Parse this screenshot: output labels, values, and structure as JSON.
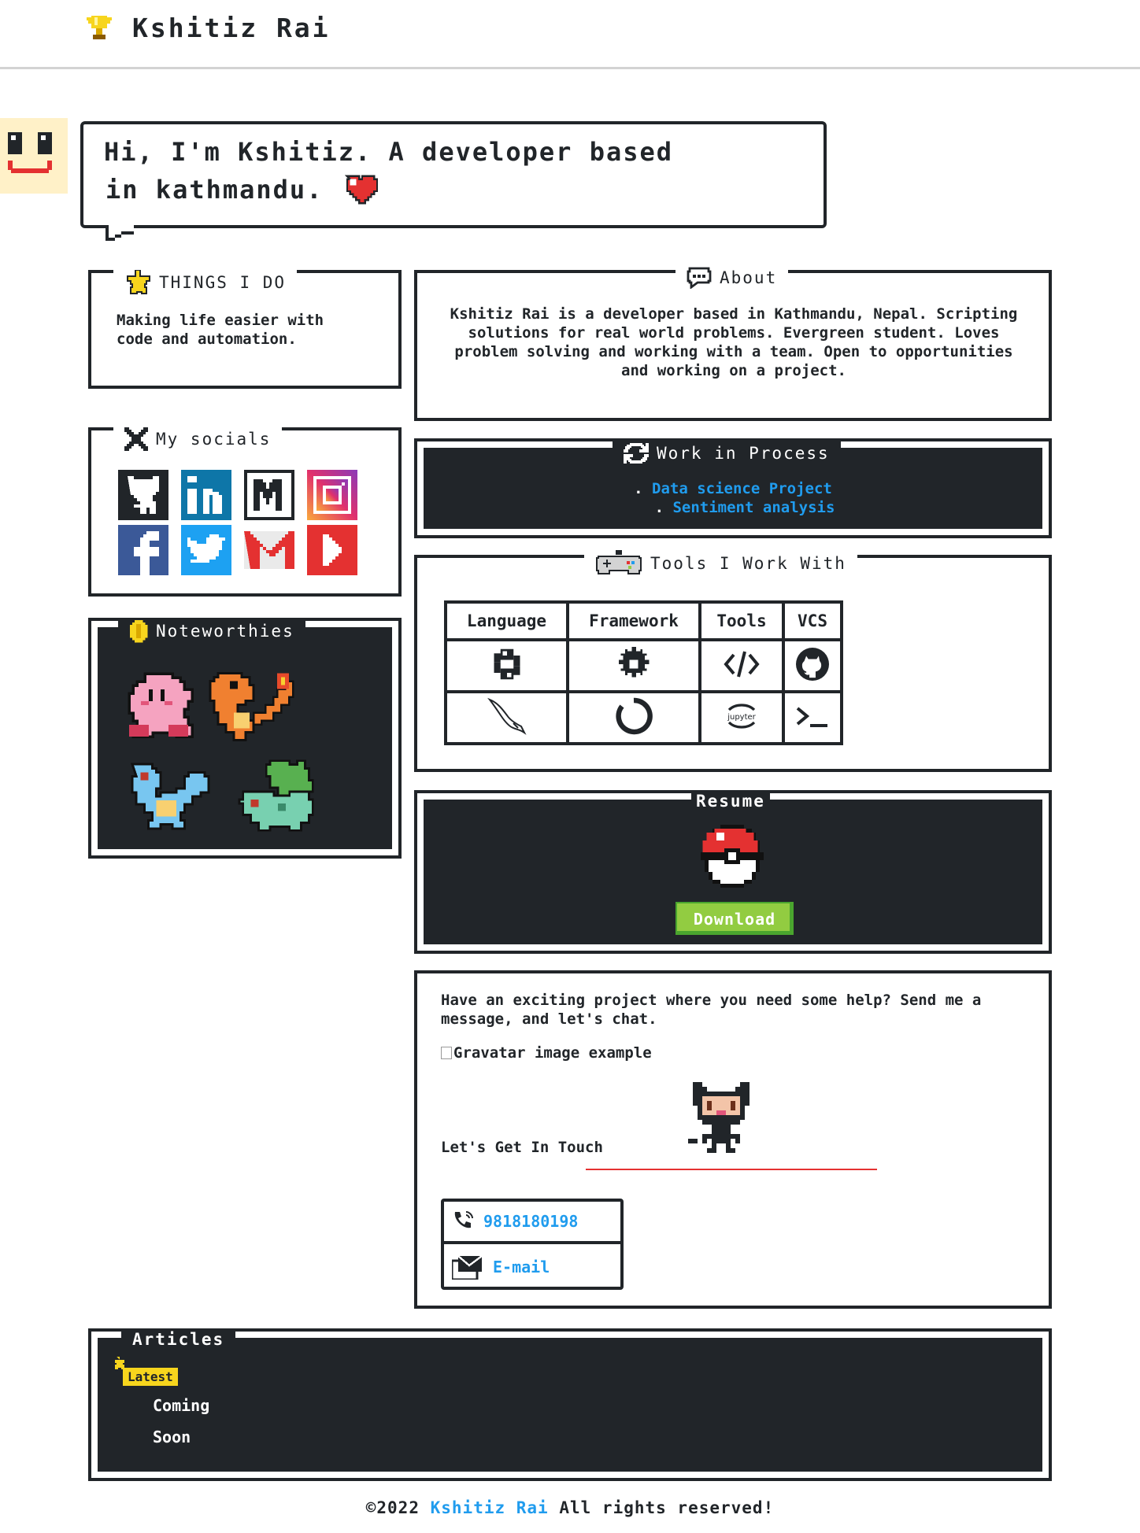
{
  "header": {
    "site_title": "Kshitiz Rai",
    "trophy_icon": "trophy-icon"
  },
  "greeting": {
    "line1": "Hi, I'm Kshitiz. A developer based",
    "line2": "in kathmandu."
  },
  "things_i_do": {
    "title": "THINGS I DO",
    "text": "Making life easier with code and automation."
  },
  "about": {
    "title": "About",
    "text": "Kshitiz Rai is a developer based in Kathmandu, Nepal. Scripting solutions for real world problems. Evergreen student. Loves problem solving and working with a team. Open to opportunities and working on a project."
  },
  "socials": {
    "title": "My socials",
    "items": [
      "github",
      "linkedin",
      "medium",
      "instagram",
      "facebook",
      "twitter",
      "gmail",
      "youtube"
    ]
  },
  "work": {
    "title": "Work in Process",
    "items": [
      "Data science Project",
      "Sentiment analysis"
    ]
  },
  "noteworthies": {
    "title": "Noteworthies",
    "items": [
      "kirby",
      "charmander",
      "squirtle",
      "bulbasaur"
    ]
  },
  "tools": {
    "title": "Tools I Work With",
    "headers": [
      "Language",
      "Framework",
      "Tools",
      "VCS"
    ],
    "row1": [
      "python-icon",
      "gear-icon",
      "code-icon",
      "github-icon"
    ],
    "row2": [
      "mysql-dolphin-icon",
      "circle-icon",
      "jupyter-icon",
      "terminal-icon"
    ],
    "jupyter_text": "jupyter"
  },
  "resume": {
    "title": "Resume",
    "download": "Download"
  },
  "contact": {
    "text": "Have an exciting project where you need some help? Send me a message, and let's chat.",
    "gravatar_alt": "Gravatar image example",
    "get_in_touch": "Let's Get In Touch",
    "phone": "9818180198",
    "email": "E-mail"
  },
  "articles": {
    "title": "Articles",
    "badge": "Latest",
    "line1": "Coming",
    "line2": "Soon"
  },
  "footer": {
    "prefix": "©2022",
    "name": "Kshitiz Rai",
    "suffix": "All rights reserved!"
  },
  "colors": {
    "link": "#209cee",
    "dark": "#212529",
    "success": "#92cc41",
    "red": "#e76e55",
    "heart": "#e43131"
  }
}
